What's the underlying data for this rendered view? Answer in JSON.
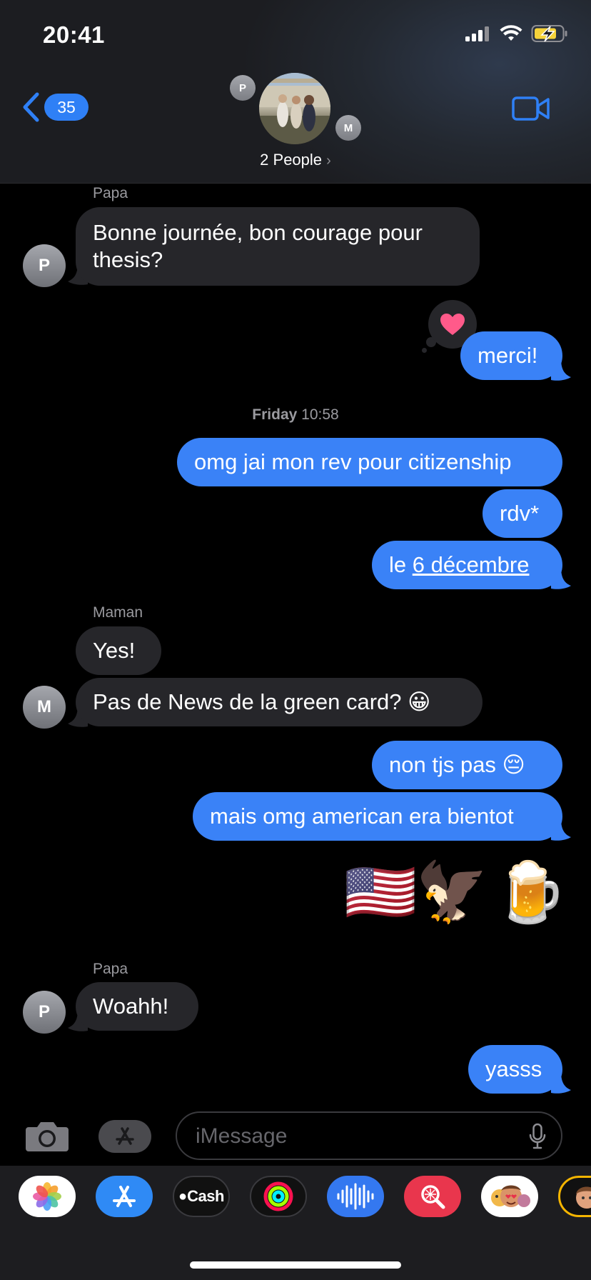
{
  "status_bar": {
    "time": "20:41"
  },
  "header": {
    "back_badge": "35",
    "participants": [
      {
        "initial": "P"
      },
      {
        "initial": "M"
      }
    ],
    "group_label": "2 People"
  },
  "conversation": {
    "messages": [
      {
        "sender": "Papa",
        "direction": "in",
        "text": "Bonne journée, bon courage pour thesis?",
        "avatar_initial": "P"
      },
      {
        "direction": "out",
        "text": "merci!",
        "tapback": "heart"
      },
      {
        "timestamp_day": "Friday",
        "timestamp_time": "10:58"
      },
      {
        "direction": "out",
        "text": "omg jai mon rev pour citizenship"
      },
      {
        "direction": "out",
        "text": "rdv*"
      },
      {
        "direction": "out",
        "text_prefix": "le ",
        "text_link": "6 décembre"
      },
      {
        "sender": "Maman",
        "direction": "in",
        "text": "Yes!"
      },
      {
        "direction": "in",
        "text": "Pas de News de la green card? 😀",
        "avatar_initial": "M"
      },
      {
        "direction": "out",
        "text": "non tjs pas 😔"
      },
      {
        "direction": "out",
        "text": "mais omg american era bientot"
      },
      {
        "direction": "out",
        "emoji": [
          "🇺🇸",
          "🦅",
          "🍺"
        ]
      },
      {
        "sender": "Papa",
        "direction": "in",
        "text": "Woahh!",
        "avatar_initial": "P"
      },
      {
        "direction": "out",
        "text": "yasss"
      }
    ]
  },
  "input": {
    "placeholder": "iMessage",
    "value": ""
  },
  "app_drawer": {
    "apps": [
      {
        "name": "photos-icon"
      },
      {
        "name": "app-store-icon"
      },
      {
        "name": "apple-cash-icon",
        "label": "Cash"
      },
      {
        "name": "activity-icon"
      },
      {
        "name": "audio-message-icon"
      },
      {
        "name": "image-search-icon"
      },
      {
        "name": "memoji-stickers-icon"
      },
      {
        "name": "memoji-icon"
      }
    ]
  },
  "colors": {
    "outgoing_bubble": "#3a82f7",
    "incoming_bubble": "#26262a",
    "accent": "#2f80f6",
    "heart": "#ff5a8a"
  }
}
